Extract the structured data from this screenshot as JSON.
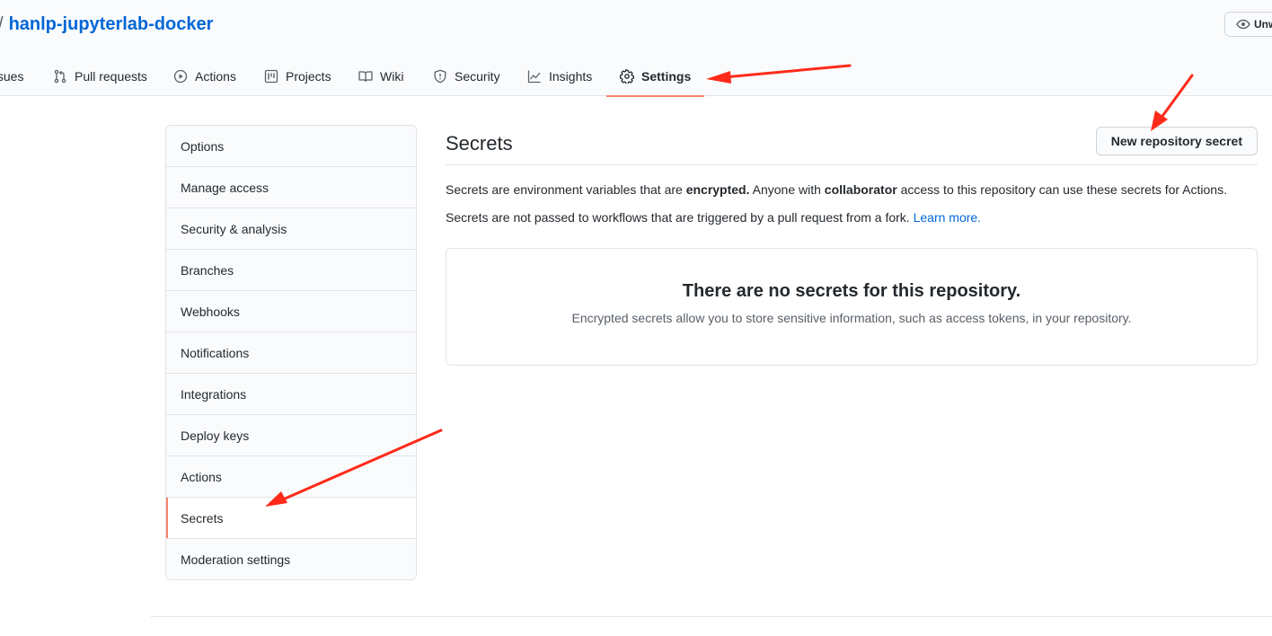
{
  "header": {
    "separator": "/",
    "repo_name": "hanlp-jupyterlab-docker",
    "watch_label": "Unwatch"
  },
  "tabs": [
    {
      "label": "Issues",
      "icon": "issue-icon"
    },
    {
      "label": "Pull requests",
      "icon": "pull-request-icon"
    },
    {
      "label": "Actions",
      "icon": "play-icon"
    },
    {
      "label": "Projects",
      "icon": "project-icon"
    },
    {
      "label": "Wiki",
      "icon": "book-icon"
    },
    {
      "label": "Security",
      "icon": "shield-icon"
    },
    {
      "label": "Insights",
      "icon": "graph-icon"
    },
    {
      "label": "Settings",
      "icon": "gear-icon",
      "selected": true
    }
  ],
  "sidebar": {
    "items": [
      {
        "label": "Options"
      },
      {
        "label": "Manage access"
      },
      {
        "label": "Security & analysis"
      },
      {
        "label": "Branches"
      },
      {
        "label": "Webhooks"
      },
      {
        "label": "Notifications"
      },
      {
        "label": "Integrations"
      },
      {
        "label": "Deploy keys"
      },
      {
        "label": "Actions"
      },
      {
        "label": "Secrets",
        "active": true
      },
      {
        "label": "Moderation settings"
      }
    ]
  },
  "main": {
    "title": "Secrets",
    "new_secret_label": "New repository secret",
    "desc1": {
      "part1": "Secrets are environment variables that are ",
      "bold1": "encrypted.",
      "part2": " Anyone with ",
      "bold2": "collaborator",
      "part3": " access to this repository can use these secrets for Actions."
    },
    "desc2": {
      "text": "Secrets are not passed to workflows that are triggered by a pull request from a fork. ",
      "link": "Learn more."
    },
    "blank": {
      "title": "There are no secrets for this repository.",
      "text": "Encrypted secrets allow you to store sensitive information, such as access tokens, in your repository."
    }
  },
  "colors": {
    "link": "#0366d6",
    "selected_underline": "#f9826c",
    "annotation_arrow": "#ff2a1a"
  }
}
